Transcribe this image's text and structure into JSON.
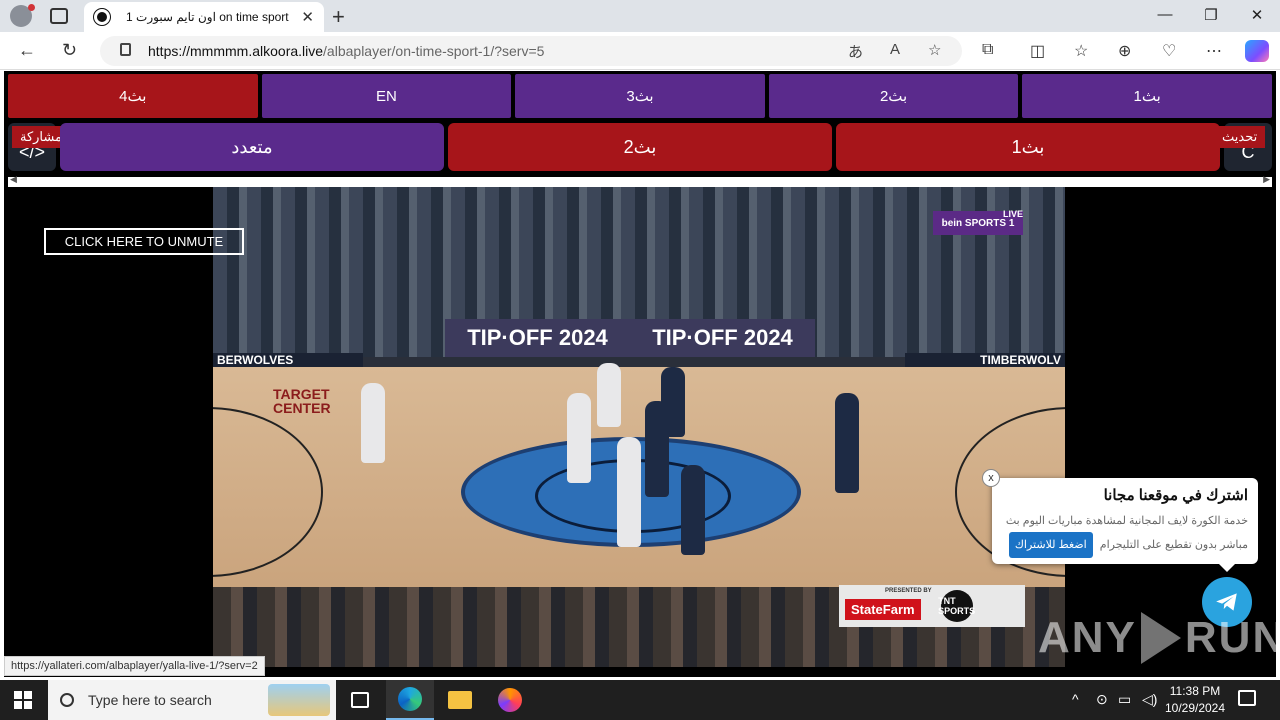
{
  "browser": {
    "tab_title": "اون تايم سبورت 1 on time sport",
    "tab_close": "✕",
    "new_tab": "+",
    "url_host": "https://mmmmm.alkoora.live",
    "url_path": "/albaplayer/on-time-sport-1/?serv=5",
    "window_controls": {
      "minimize": "—",
      "maximize": "❐",
      "close": "✕"
    }
  },
  "servers_row": [
    {
      "label": "بث4",
      "color": "#a7151a"
    },
    {
      "label": "EN",
      "color": "#5a2a8c"
    },
    {
      "label": "بث3",
      "color": "#5a2a8c"
    },
    {
      "label": "بث2",
      "color": "#5a2a8c"
    },
    {
      "label": "بث1",
      "color": "#5a2a8c"
    }
  ],
  "second_row": {
    "share_label": "مشاركة",
    "share_icon": "</>",
    "refresh_label": "تحديث",
    "refresh_icon": "C",
    "multi_label": "متعدد",
    "stream2_label": "بث2",
    "stream1_label": "بث1"
  },
  "video": {
    "unmute_label": "CLICK HERE TO UNMUTE",
    "board_text_left": "TIP·OFF 2024",
    "board_text_right": "TIP·OFF 2024",
    "wolves_left": "BERWOLVES",
    "wolves_right": "TIMBERWOLV",
    "target_line1": "TARGET",
    "target_line2": "CENTER",
    "network_badge": "bein SPORTS 1",
    "live_label": "LIVE",
    "sponsor_presented": "PRESENTED BY",
    "sponsor_name": "StateFarm",
    "tnt_label": "TNT SPORTS"
  },
  "popup": {
    "close": "x",
    "title": "اشترك في موقعنا مجانا",
    "text_line1": "خدمة الكورة لايف المجانية لمشاهدة مباريات اليوم بث",
    "text_line2": "مباشر بدون تقطيع على التليجرام",
    "cta": "اضغط للاشتراك"
  },
  "watermark": {
    "left": "ANY",
    "right": "RUN"
  },
  "status_url": "https://yallateri.com/albaplayer/yalla-live-1/?serv=2",
  "taskbar": {
    "search_placeholder": "Type here to search",
    "time": "11:38 PM",
    "date": "10/29/2024"
  }
}
